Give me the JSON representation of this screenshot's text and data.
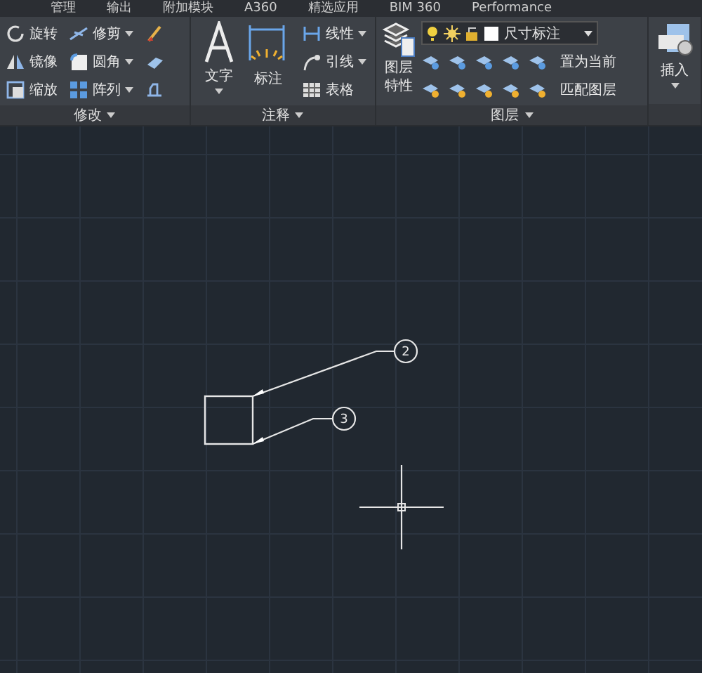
{
  "ribbon_tabs": [
    "管理",
    "输出",
    "附加模块",
    "A360",
    "精选应用",
    "BIM 360",
    "Performance"
  ],
  "panels": [
    {
      "kind": "modify",
      "title": "修改",
      "rows": [
        [
          {
            "label": "旋转",
            "dropdown": false
          },
          {
            "label": "修剪",
            "dropdown": true
          },
          {}
        ],
        [
          {
            "label": "镜像",
            "dropdown": false
          },
          {
            "label": "圆角",
            "dropdown": true
          },
          {}
        ],
        [
          {
            "label": "缩放",
            "dropdown": false
          },
          {
            "label": "阵列",
            "dropdown": true
          },
          {}
        ]
      ]
    },
    {
      "kind": "annotation",
      "title": "注释",
      "large": [
        {
          "label": "文字",
          "dropdown": true
        },
        {
          "label": "标注",
          "dropdown": false
        }
      ],
      "items": [
        {
          "label": "线性",
          "dropdown": true
        },
        {
          "label": "引线",
          "dropdown": true
        },
        {
          "label": "表格",
          "dropdown": false
        }
      ]
    },
    {
      "kind": "layers",
      "title": "图层",
      "large": {
        "label": "图层特性"
      },
      "layer_dropdown": {
        "value": "尺寸标注"
      },
      "actions": [
        "置为当前",
        "匹配图层"
      ]
    },
    {
      "kind": "insert",
      "large": {
        "label": "插入",
        "dropdown": true
      }
    }
  ],
  "canvas": {
    "balloons": [
      {
        "label": "2"
      },
      {
        "label": "3"
      }
    ]
  }
}
